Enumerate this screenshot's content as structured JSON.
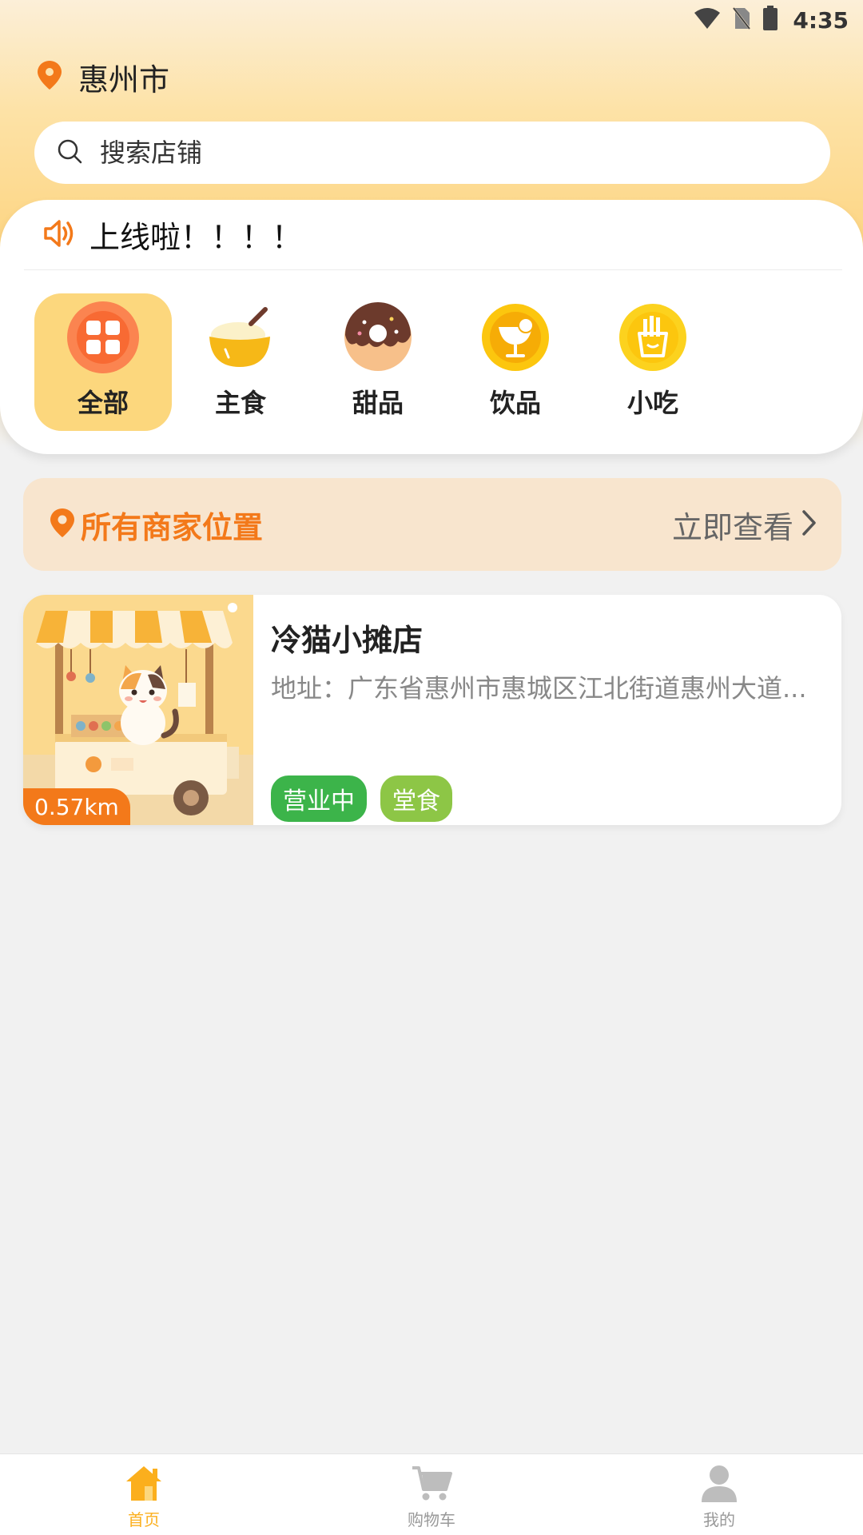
{
  "status_bar": {
    "time": "4:35"
  },
  "header": {
    "city": "惠州市"
  },
  "search": {
    "placeholder": "搜索店铺"
  },
  "notice": {
    "text": "上线啦！！！！"
  },
  "categories": [
    {
      "label": "全部",
      "icon": "grid-icon",
      "active": true
    },
    {
      "label": "主食",
      "icon": "rice-bowl-icon"
    },
    {
      "label": "甜品",
      "icon": "donut-icon"
    },
    {
      "label": "饮品",
      "icon": "drink-icon"
    },
    {
      "label": "小吃",
      "icon": "fries-icon"
    }
  ],
  "merchant_banner": {
    "title": "所有商家位置",
    "action": "立即查看"
  },
  "shops": [
    {
      "name": "冷猫小摊店",
      "address": "地址：广东省惠州市惠城区江北街道惠州大道...",
      "distance": "0.57km",
      "tags": [
        "营业中",
        "堂食"
      ]
    }
  ],
  "bottom_nav": [
    {
      "label": "首页",
      "icon": "home-icon",
      "active": true
    },
    {
      "label": "购物车",
      "icon": "cart-icon"
    },
    {
      "label": "我的",
      "icon": "user-icon"
    }
  ],
  "colors": {
    "accent": "#f3791a",
    "nav_active": "#fbaf1d",
    "category_active_bg": "#fcd77d",
    "tag_open": "#3cb44a",
    "tag_dine": "#8dc646"
  }
}
